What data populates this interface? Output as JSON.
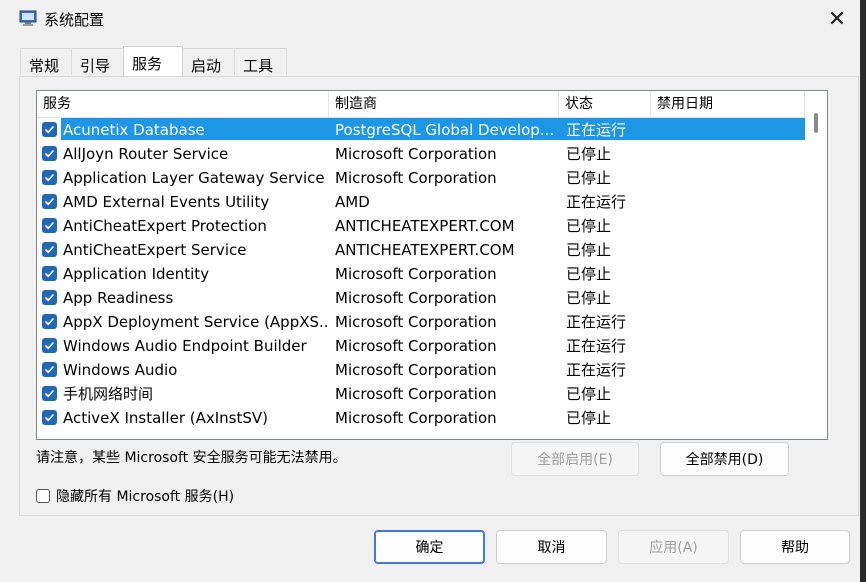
{
  "window": {
    "title": "系统配置",
    "close_glyph": "✕"
  },
  "tabs": [
    "常规",
    "引导",
    "服务",
    "启动",
    "工具"
  ],
  "active_tab": 2,
  "columns": {
    "service": "服务",
    "manufacturer": "制造商",
    "status": "状态",
    "disabled_date": "禁用日期"
  },
  "services": [
    {
      "name": "Acunetix Database",
      "manufacturer": "PostgreSQL Global Develop...",
      "status": "正在运行",
      "disabled_date": "",
      "checked": true,
      "selected": true
    },
    {
      "name": "AllJoyn Router Service",
      "manufacturer": "Microsoft Corporation",
      "status": "已停止",
      "disabled_date": "",
      "checked": true
    },
    {
      "name": "Application Layer Gateway Service",
      "manufacturer": "Microsoft Corporation",
      "status": "已停止",
      "disabled_date": "",
      "checked": true
    },
    {
      "name": "AMD External Events Utility",
      "manufacturer": "AMD",
      "status": "正在运行",
      "disabled_date": "",
      "checked": true
    },
    {
      "name": "AntiCheatExpert Protection",
      "manufacturer": "ANTICHEATEXPERT.COM",
      "status": "已停止",
      "disabled_date": "",
      "checked": true
    },
    {
      "name": "AntiCheatExpert Service",
      "manufacturer": "ANTICHEATEXPERT.COM",
      "status": "已停止",
      "disabled_date": "",
      "checked": true
    },
    {
      "name": "Application Identity",
      "manufacturer": "Microsoft Corporation",
      "status": "已停止",
      "disabled_date": "",
      "checked": true
    },
    {
      "name": "App Readiness",
      "manufacturer": "Microsoft Corporation",
      "status": "已停止",
      "disabled_date": "",
      "checked": true
    },
    {
      "name": "AppX Deployment Service (AppXS...",
      "manufacturer": "Microsoft Corporation",
      "status": "正在运行",
      "disabled_date": "",
      "checked": true
    },
    {
      "name": "Windows Audio Endpoint Builder",
      "manufacturer": "Microsoft Corporation",
      "status": "正在运行",
      "disabled_date": "",
      "checked": true
    },
    {
      "name": "Windows Audio",
      "manufacturer": "Microsoft Corporation",
      "status": "正在运行",
      "disabled_date": "",
      "checked": true
    },
    {
      "name": "手机网络时间",
      "manufacturer": "Microsoft Corporation",
      "status": "已停止",
      "disabled_date": "",
      "checked": true
    },
    {
      "name": "ActiveX Installer (AxInstSV)",
      "manufacturer": "Microsoft Corporation",
      "status": "已停止",
      "disabled_date": "",
      "checked": true
    }
  ],
  "note": "请注意，某些 Microsoft 安全服务可能无法禁用。",
  "buttons": {
    "enable_all": "全部启用(E)",
    "disable_all": "全部禁用(D)",
    "ok": "确定",
    "cancel": "取消",
    "apply": "应用(A)",
    "help": "帮助"
  },
  "hide_ms": {
    "label": "隐藏所有 Microsoft 服务(H)",
    "checked": false
  },
  "colors": {
    "selection": "#1e96e6",
    "checkbox": "#2368b4",
    "primary_border": "#3d7ad0"
  }
}
